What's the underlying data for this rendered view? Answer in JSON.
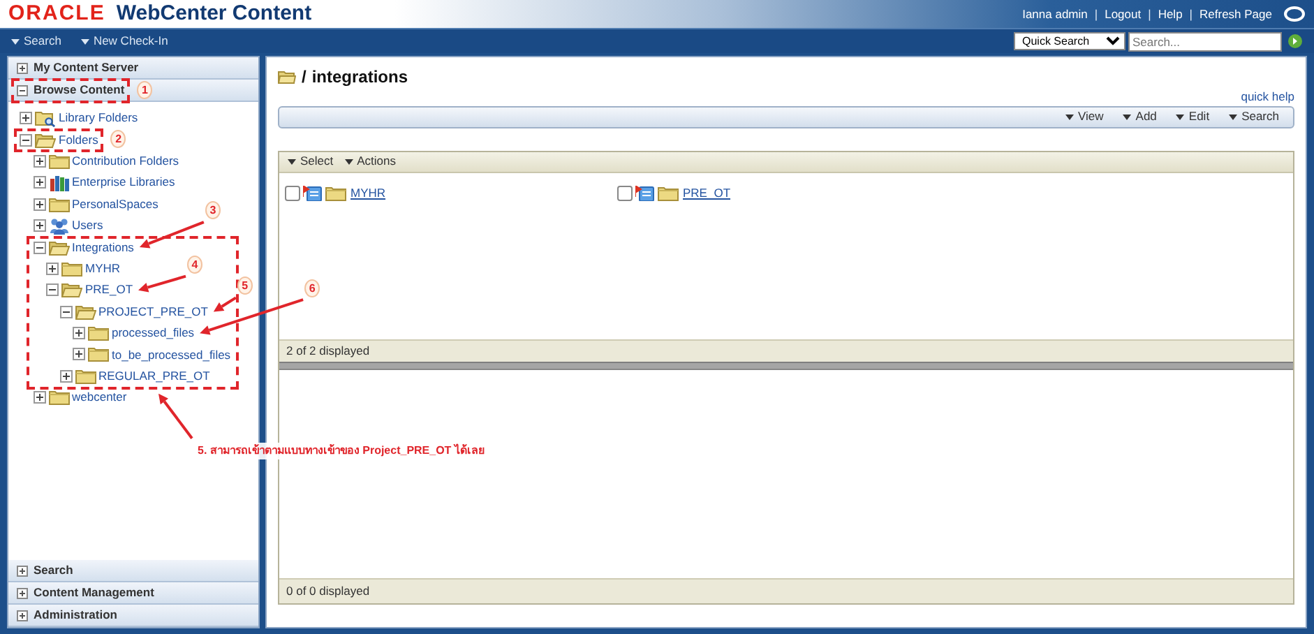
{
  "header": {
    "logo_brand": "ORACLE",
    "logo_product": "WebCenter Content",
    "user_links": [
      "Ianna admin",
      "Logout",
      "Help",
      "Refresh Page"
    ],
    "separator": "|"
  },
  "nav": {
    "menus": [
      "Search",
      "New Check-In"
    ],
    "quick_search": {
      "value": "Quick Search"
    },
    "search_field": {
      "placeholder": "Search..."
    }
  },
  "sidebar": {
    "sections": [
      {
        "title": "My Content Server",
        "expanded": false
      },
      {
        "title": "Browse Content",
        "expanded": true,
        "tree": [
          {
            "label": "Library Folders",
            "kind": "library",
            "expanded": false
          },
          {
            "label": "Folders",
            "kind": "folder",
            "expanded": true,
            "children": [
              {
                "label": "Contribution Folders",
                "kind": "folder",
                "expanded": false
              },
              {
                "label": "Enterprise Libraries",
                "kind": "enterprise",
                "expanded": false
              },
              {
                "label": "PersonalSpaces",
                "kind": "folder",
                "expanded": false
              },
              {
                "label": "Users",
                "kind": "users",
                "expanded": false
              },
              {
                "label": "Integrations",
                "kind": "folder",
                "expanded": true,
                "children": [
                  {
                    "label": "MYHR",
                    "kind": "folder",
                    "expanded": false
                  },
                  {
                    "label": "PRE_OT",
                    "kind": "folder",
                    "expanded": true,
                    "children": [
                      {
                        "label": "PROJECT_PRE_OT",
                        "kind": "folder",
                        "expanded": true,
                        "children": [
                          {
                            "label": "processed_files",
                            "kind": "folder",
                            "expanded": false
                          },
                          {
                            "label": "to_be_processed_files",
                            "kind": "folder",
                            "expanded": false
                          }
                        ]
                      },
                      {
                        "label": "REGULAR_PRE_OT",
                        "kind": "folder",
                        "expanded": false
                      }
                    ]
                  }
                ]
              },
              {
                "label": "webcenter",
                "kind": "folder",
                "expanded": false
              }
            ]
          }
        ]
      },
      {
        "title": "Search",
        "expanded": false
      },
      {
        "title": "Content Management",
        "expanded": false
      },
      {
        "title": "Administration",
        "expanded": false
      }
    ]
  },
  "content": {
    "title_separator": "/",
    "title": "integrations",
    "quick_help": "quick help",
    "toolbar_menus": [
      "View",
      "Add",
      "Edit",
      "Search"
    ],
    "grid": {
      "menus": [
        "Select",
        "Actions"
      ],
      "items": [
        {
          "label": "MYHR",
          "checked": false
        },
        {
          "label": "PRE_OT",
          "checked": false
        }
      ],
      "footer": "2 of 2 displayed"
    },
    "lower_footer": "0 of 0 displayed"
  },
  "annotations": {
    "callouts": [
      {
        "label": "1"
      },
      {
        "label": "2"
      },
      {
        "label": "3"
      },
      {
        "label": "4"
      },
      {
        "label": "5"
      },
      {
        "label": "6"
      }
    ],
    "note": "5. สามารถเข้าตามแบบทางเข้าของ Project_PRE_OT ได้เลย"
  }
}
